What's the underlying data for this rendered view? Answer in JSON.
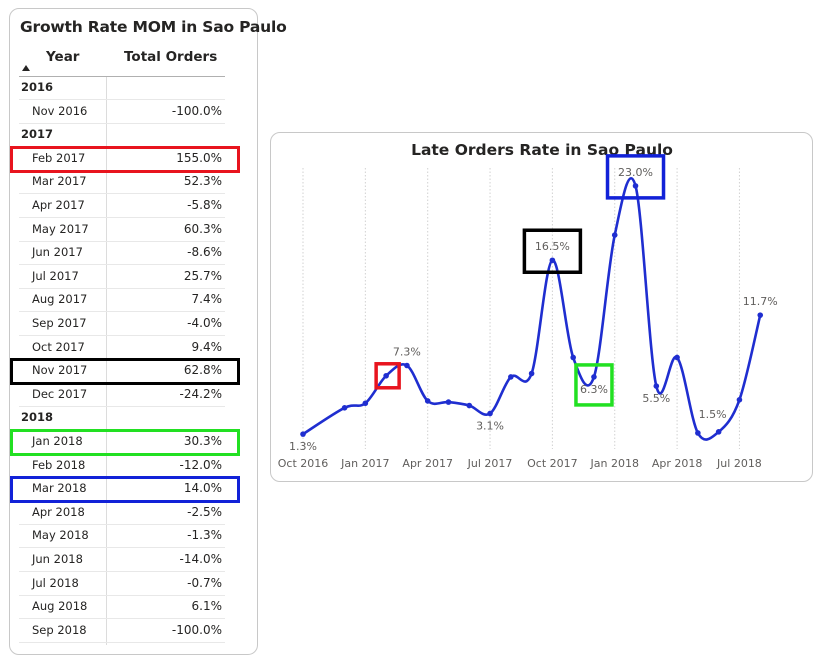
{
  "table": {
    "title": "Growth Rate MOM in Sao Paulo",
    "col_year": "Year",
    "col_orders": "Total Orders",
    "rows": [
      {
        "label": "2016",
        "value": "",
        "group": true
      },
      {
        "label": "Nov 2016",
        "value": "-100.0%"
      },
      {
        "label": "2017",
        "value": "",
        "group": true
      },
      {
        "label": "Feb 2017",
        "value": "155.0%",
        "highlight": "#e8141e"
      },
      {
        "label": "Mar 2017",
        "value": "52.3%"
      },
      {
        "label": "Apr 2017",
        "value": "-5.8%"
      },
      {
        "label": "May 2017",
        "value": "60.3%"
      },
      {
        "label": "Jun 2017",
        "value": "-8.6%"
      },
      {
        "label": "Jul 2017",
        "value": "25.7%"
      },
      {
        "label": "Aug 2017",
        "value": "7.4%"
      },
      {
        "label": "Sep 2017",
        "value": "-4.0%"
      },
      {
        "label": "Oct 2017",
        "value": "9.4%"
      },
      {
        "label": "Nov 2017",
        "value": "62.8%",
        "highlight": "#000000"
      },
      {
        "label": "Dec 2017",
        "value": "-24.2%"
      },
      {
        "label": "2018",
        "value": "",
        "group": true
      },
      {
        "label": "Jan 2018",
        "value": "30.3%",
        "highlight": "#22e022"
      },
      {
        "label": "Feb 2018",
        "value": "-12.0%"
      },
      {
        "label": "Mar 2018",
        "value": "14.0%",
        "highlight": "#1222d8"
      },
      {
        "label": "Apr 2018",
        "value": "-2.5%"
      },
      {
        "label": "May 2018",
        "value": "-1.3%"
      },
      {
        "label": "Jun 2018",
        "value": "-14.0%"
      },
      {
        "label": "Jul 2018",
        "value": "-0.7%"
      },
      {
        "label": "Aug 2018",
        "value": "6.1%"
      },
      {
        "label": "Sep 2018",
        "value": "-100.0%"
      }
    ]
  },
  "chart_data": {
    "type": "line",
    "title": "Late Orders Rate in Sao Paulo",
    "xlabel": "",
    "ylabel": "",
    "line_color": "#1f2ed0",
    "grid": "vertical-dotted",
    "x_tick_labels": [
      "Oct 2016",
      "Jan 2017",
      "Apr 2017",
      "Jul 2017",
      "Oct 2017",
      "Jan 2018",
      "Apr 2018",
      "Jul 2018"
    ],
    "x": [
      "Oct 2016",
      "Dec 2016",
      "Jan 2017",
      "Feb 2017",
      "Mar 2017",
      "Apr 2017",
      "May 2017",
      "Jun 2017",
      "Jul 2017",
      "Aug 2017",
      "Sep 2017",
      "Oct 2017",
      "Nov 2017",
      "Dec 2017",
      "Jan 2018",
      "Feb 2018",
      "Mar 2018",
      "Apr 2018",
      "May 2018",
      "Jun 2018",
      "Jul 2018",
      "Aug 2018"
    ],
    "month_index": [
      0,
      2,
      3,
      4,
      5,
      6,
      7,
      8,
      9,
      10,
      11,
      12,
      13,
      14,
      15,
      16,
      17,
      18,
      19,
      20,
      21,
      22
    ],
    "values": [
      1.3,
      3.6,
      4.0,
      6.4,
      7.3,
      4.2,
      4.1,
      3.8,
      3.1,
      6.3,
      6.6,
      16.5,
      8.0,
      6.3,
      18.7,
      23.0,
      5.5,
      8.0,
      1.4,
      1.5,
      4.3,
      11.7
    ],
    "data_labels": [
      {
        "index": 0,
        "text": "1.3%",
        "pos": "below"
      },
      {
        "index": 4,
        "text": "7.3%",
        "pos": "above"
      },
      {
        "index": 8,
        "text": "3.1%",
        "pos": "below"
      },
      {
        "index": 11,
        "text": "16.5%",
        "pos": "above"
      },
      {
        "index": 13,
        "text": "6.3%",
        "pos": "below"
      },
      {
        "index": 15,
        "text": "23.0%",
        "pos": "above"
      },
      {
        "index": 16,
        "text": "5.5%",
        "pos": "below"
      },
      {
        "index": 19,
        "text": "1.5%",
        "pos": "above-left"
      },
      {
        "index": 21,
        "text": "11.7%",
        "pos": "above"
      }
    ],
    "highlights": [
      {
        "index": 3,
        "color": "#e8141e"
      },
      {
        "index": 11,
        "color": "#000000"
      },
      {
        "index": 13,
        "color": "#22e022"
      },
      {
        "index": 15,
        "color": "#1222d8"
      }
    ],
    "ylim": [
      0,
      25
    ]
  }
}
